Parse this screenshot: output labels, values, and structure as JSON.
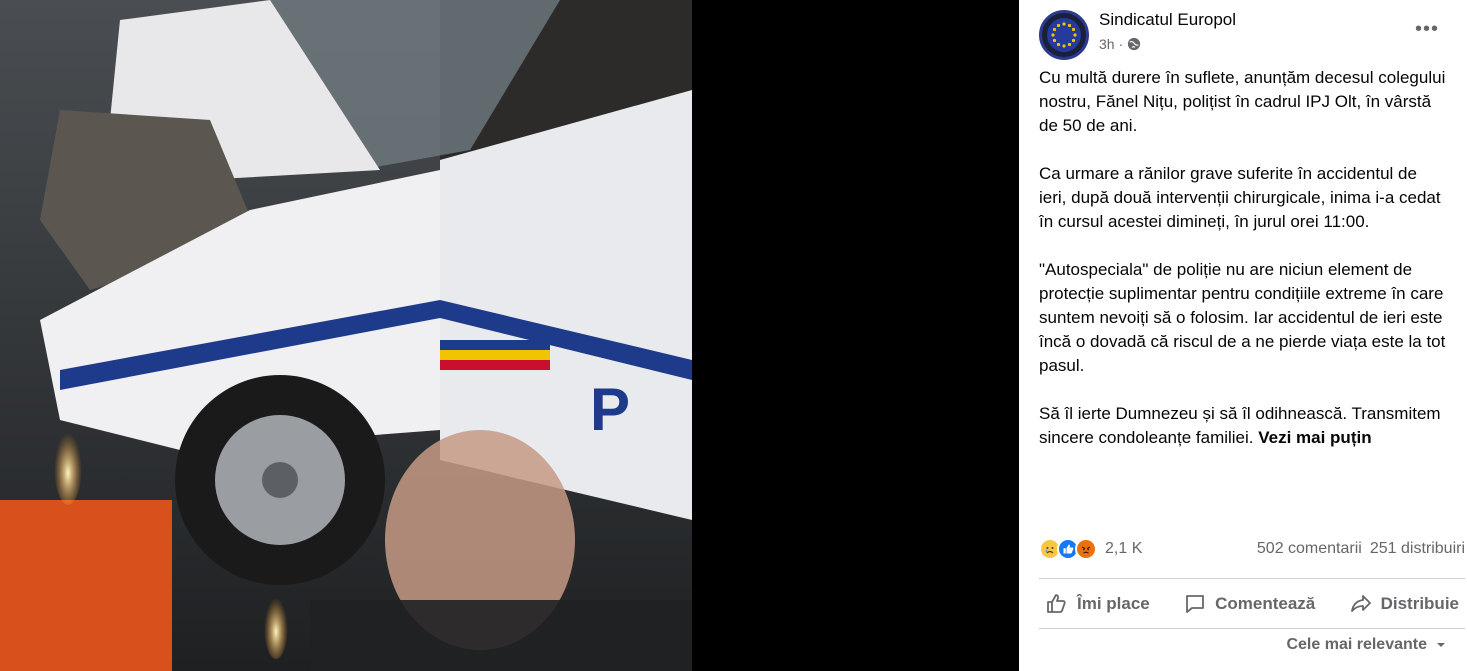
{
  "post": {
    "page_name": "Sindicatul Europol",
    "time": "3h",
    "more_label": "•••",
    "paragraphs": [
      "Cu multă durere în suflete, anunțăm decesul colegului nostru, Fănel Nițu, polițist în cadrul IPJ Olt, în vârstă de 50 de ani.",
      "Ca urmare a rănilor grave suferite în accidentul de ieri, după două intervenții chirurgicale, inima i-a cedat în cursul acestei dimineți, în jurul orei 11:00.",
      "\"Autospeciala\" de poliție nu are niciun element de protecție suplimentar pentru condițiile extreme în care suntem nevoiți să o folosim. Iar accidentul de ieri este încă o dovadă că riscul de a ne pierde viața este la tot pasul."
    ],
    "last_paragraph": "Să îl ierte Dumnezeu și să îl odihnească. Transmitem sincere condoleanțe familiei. ",
    "see_less": "Vezi mai puțin"
  },
  "stats": {
    "reaction_count": "2,1 K",
    "comments": "502 comentarii",
    "shares": "251 distribuiri"
  },
  "actions": {
    "like": "Îmi place",
    "comment": "Comentează",
    "share": "Distribuie"
  },
  "sort_label": "Cele mai relevante",
  "colors": {
    "text": "#050505",
    "secondary": "#65676b",
    "like_blue": "#1877f2"
  },
  "icons": [
    "globe-icon",
    "sad-reaction-icon",
    "like-reaction-icon",
    "angry-reaction-icon",
    "thumbs-up-icon",
    "comment-icon",
    "share-icon",
    "chevron-down-icon",
    "more-icon"
  ]
}
